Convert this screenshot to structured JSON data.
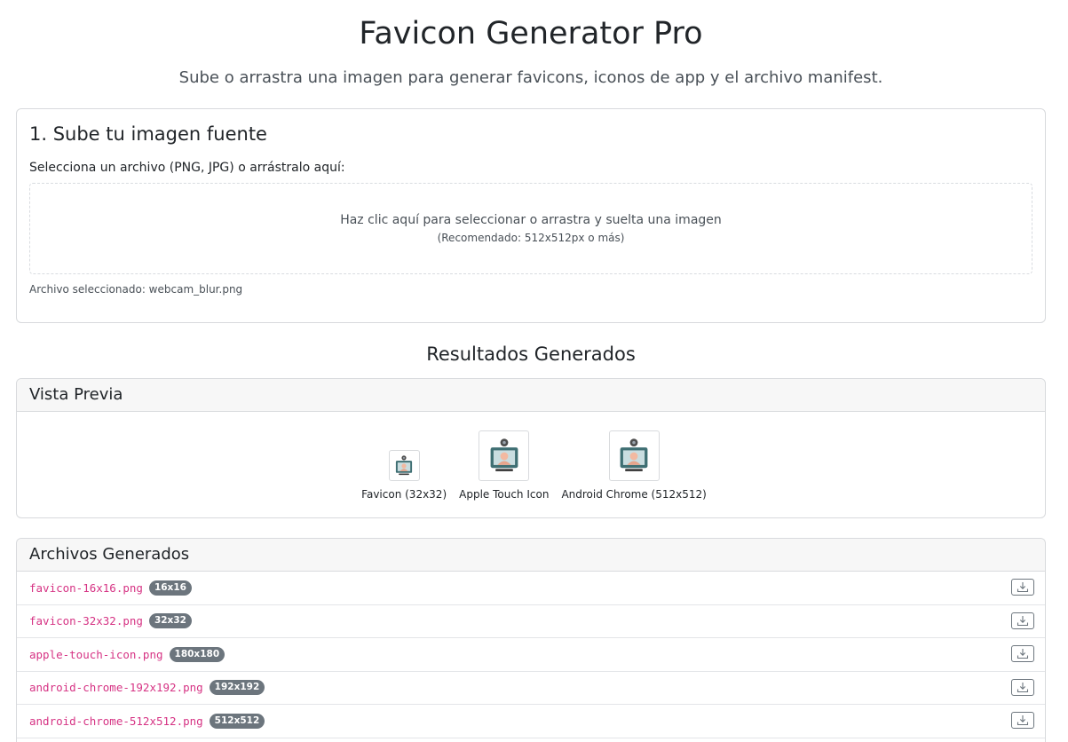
{
  "header": {
    "title": "Favicon Generator Pro",
    "subtitle": "Sube o arrastra una imagen para generar favicons, iconos de app y el archivo manifest."
  },
  "upload": {
    "section_title": "1. Sube tu imagen fuente",
    "file_label": "Selecciona un archivo (PNG, JPG) o arrástralo aquí:",
    "dropzone_text": "Haz clic aquí para seleccionar o arrastra y suelta una imagen",
    "dropzone_hint": "(Recomendado: 512x512px o más)",
    "selected_file": "Archivo seleccionado: webcam_blur.png"
  },
  "results": {
    "title": "Resultados Generados",
    "preview": {
      "header": "Vista Previa",
      "items": [
        {
          "caption": "Favicon (32x32)",
          "icon": "webcam-person-icon"
        },
        {
          "caption": "Apple Touch Icon",
          "icon": "webcam-person-icon"
        },
        {
          "caption": "Android Chrome (512x512)",
          "icon": "webcam-person-icon"
        }
      ]
    },
    "files": {
      "header": "Archivos Generados",
      "items": [
        {
          "name": "favicon-16x16.png",
          "size": "16x16",
          "action_icon": "download-icon"
        },
        {
          "name": "favicon-32x32.png",
          "size": "32x32",
          "action_icon": "download-icon"
        },
        {
          "name": "apple-touch-icon.png",
          "size": "180x180",
          "action_icon": "download-icon"
        },
        {
          "name": "android-chrome-192x192.png",
          "size": "192x192",
          "action_icon": "download-icon"
        },
        {
          "name": "android-chrome-512x512.png",
          "size": "512x512",
          "action_icon": "download-icon"
        }
      ]
    }
  },
  "colors": {
    "filename": "#d63384",
    "badge": "#6c757d",
    "card_border": "#d8dadd",
    "card_header_bg": "#f7f7f7"
  }
}
